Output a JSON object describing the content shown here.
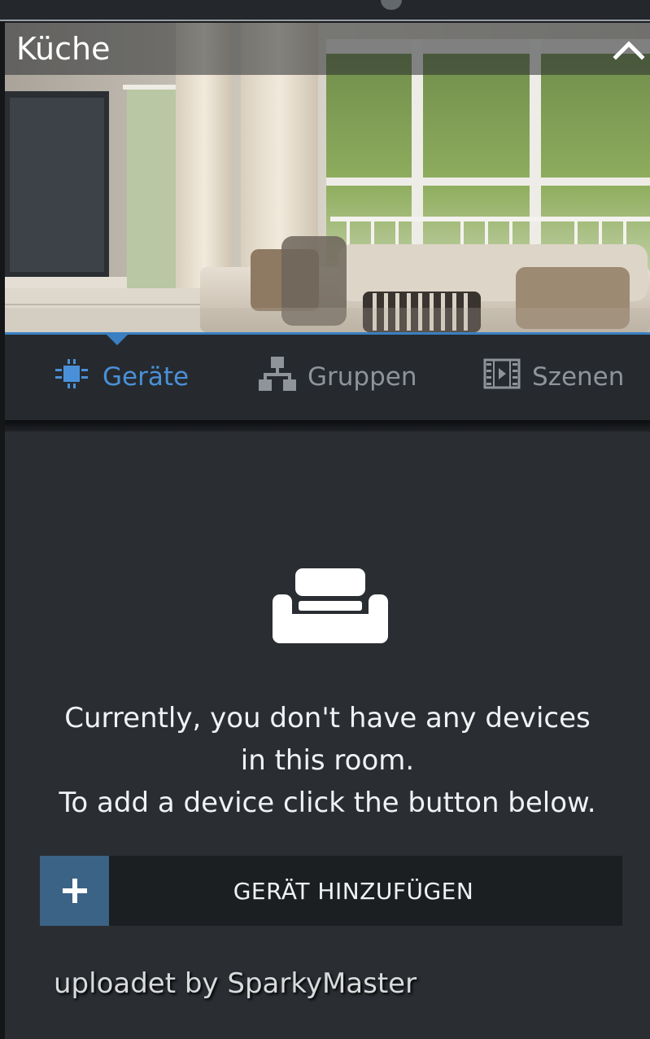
{
  "room": {
    "title": "Küche"
  },
  "tabs": [
    {
      "label": "Geräte",
      "icon": "chip-icon",
      "active": true
    },
    {
      "label": "Gruppen",
      "icon": "hierarchy-icon",
      "active": false
    },
    {
      "label": "Szenen",
      "icon": "film-icon",
      "active": false
    }
  ],
  "empty_state": {
    "icon": "sofa-icon",
    "lines": [
      "Currently, you don't have any devices",
      "in this room.",
      "To add a device click the button below."
    ]
  },
  "add_button": {
    "label": "GERÄT HINZUFÜGEN",
    "icon": "plus-icon"
  },
  "watermark": "uploadet by SparkyMaster",
  "colors": {
    "accent": "#4a90d9",
    "tab_inactive": "#8e949a",
    "button_icon_bg": "#3b6385",
    "content_bg": "#2a2e33"
  }
}
